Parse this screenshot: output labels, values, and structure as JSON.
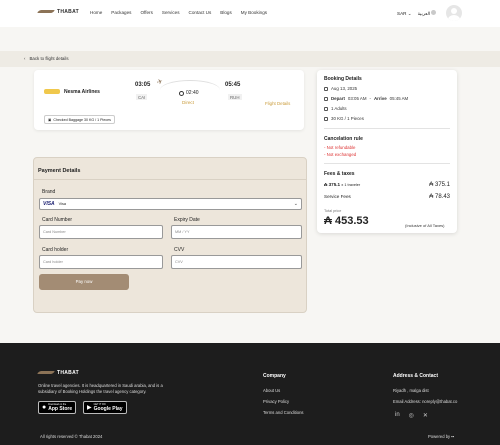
{
  "brand": {
    "name": "THABAT"
  },
  "nav": [
    "Home",
    "Packages",
    "Offers",
    "Services",
    "Contact Us",
    "Blogs",
    "My Bookings"
  ],
  "header": {
    "currency": "SAR",
    "language": "العربية"
  },
  "back_link": "Back to flight details",
  "flight": {
    "airline": "Nesma Airlines",
    "departure_time": "03:05",
    "departure_code": "CAI",
    "arrival_time": "05:45",
    "arrival_code": "RUH",
    "duration": "02:40",
    "stops": "Direct",
    "details_link": "Flight Details",
    "baggage": "Checked Baggage 30 KG / 1 Pieces"
  },
  "booking": {
    "title": "Booking Details",
    "date": "Aug 13, 2025",
    "depart_label": "Depart",
    "depart_time": "03:05 AM",
    "arrive_label": "Arrive",
    "arrive_time": "05:45 AM",
    "passengers": "1 Adults",
    "baggage": "30 KG / 1 Pieces",
    "cancel_title": "Cancelation rule",
    "rules": [
      "- Not refundable",
      "- Not exchanged"
    ],
    "fees_title": "Fees & taxes",
    "fare_line": "375.1",
    "fare_multiplier": "x 1 traveler",
    "fare_total": "375.1",
    "service_label": "Service Fees",
    "service_value": "78.43",
    "total_label": "Total price",
    "total": "453.53",
    "total_note": "(Inclusive of All Taxes)"
  },
  "payment": {
    "title": "Payment Details",
    "brand_label": "Brand",
    "brand_value": "Visa",
    "card_number_label": "Card Number",
    "card_number_placeholder": "Card Number",
    "expiry_label": "Expiry Date",
    "expiry_placeholder": "MM / YY",
    "holder_label": "Card holder",
    "holder_placeholder": "Card holder",
    "cvv_label": "CVV",
    "cvv_placeholder": "CVV",
    "pay_button": "Pay now"
  },
  "footer": {
    "description": "Online travel agencies. It is headquartered in Saudi arabia, and is a subsidiary of Booking Holdings the travel agency category.",
    "app_store_small": "Download on the",
    "app_store_big": "App Store",
    "google_small": "GET IT ON",
    "google_big": "Google Play",
    "company_title": "Company",
    "company_links": [
      "About Us",
      "Privacy Policy",
      "Terms and Conditions"
    ],
    "address_title": "Address & Contact",
    "address": "Riyadh , malga dist",
    "email": "Email Address: noreply@thabat.co",
    "copyright": "All rights reserved © Thabat 2024",
    "powered": "Powered by"
  }
}
